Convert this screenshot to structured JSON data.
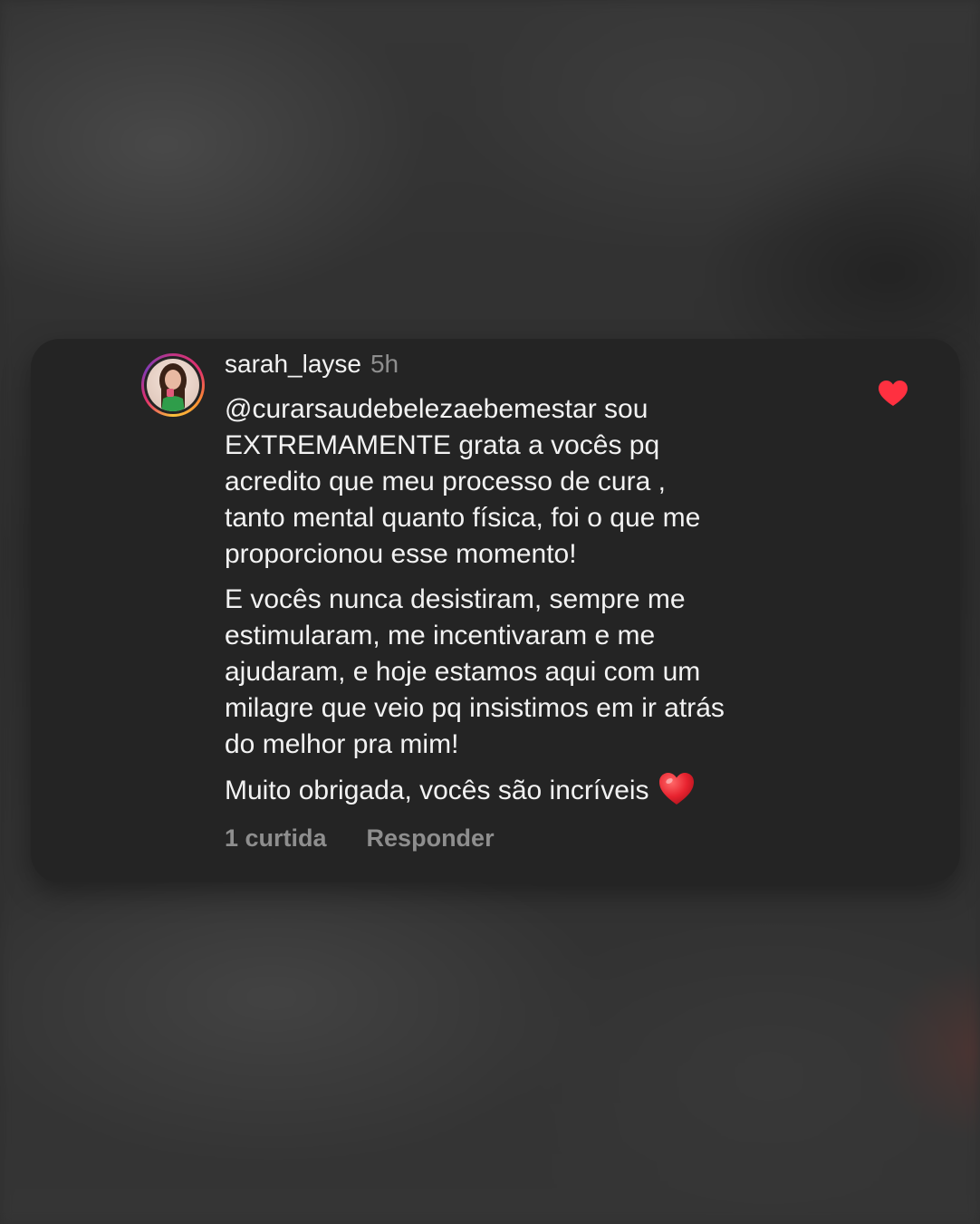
{
  "comment": {
    "username": "sarah_layse",
    "time": "5h",
    "paragraphs": [
      "@curarsaudebelezaebemestar sou\nEXTREMAMENTE grata a vocês pq\nacredito que meu processo de cura ,\ntanto mental quanto física, foi o que me\nproporcionou esse momento!",
      "E vocês nunca desistiram, sempre me\nestimularam, me incentivaram e me\najudaram, e hoje estamos aqui com um\nmilagre que veio pq insistimos em ir atrás\ndo melhor pra mim!",
      "Muito obrigada, vocês são incríveis"
    ],
    "likes_label": "1 curtida",
    "reply_label": "Responder",
    "liked": true,
    "emoji": "red-heart-icon"
  },
  "colors": {
    "card_bg": "#242424",
    "text": "#f2f2f2",
    "muted": "#8e8e8e",
    "like": "#ff3040"
  }
}
